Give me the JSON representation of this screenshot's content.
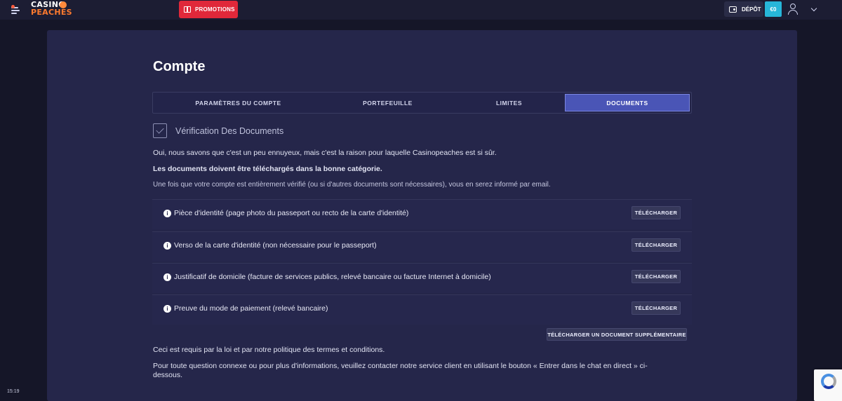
{
  "header": {
    "logo_line1": "CASINO",
    "logo_line2": "PEACHES",
    "promo_label": "PROMOTIONS",
    "deposit_label": "DÉPÔT",
    "balance": "€0"
  },
  "page": {
    "title": "Compte"
  },
  "tabs": [
    {
      "label": "PARAMÈTRES DU COMPTE",
      "active": false
    },
    {
      "label": "PORTEFEUILLE",
      "active": false
    },
    {
      "label": "LIMITES",
      "active": false
    },
    {
      "label": "DOCUMENTS",
      "active": true
    }
  ],
  "verification": {
    "title": "Vérification Des Documents",
    "intro": "Oui, nous savons que c'est un peu ennuyeux, mais c'est la raison pour laquelle Casinopeaches est si sûr.",
    "warning": "Les documents doivent être téléchargés dans la bonne catégorie.",
    "notice": "Une fois que votre compte est entièrement vérifié (ou si d'autres documents sont nécessaires), vous en serez informé par email."
  },
  "documents": [
    {
      "label": "Pièce d'identité (page photo du passeport ou recto de la carte d'identité)",
      "button": "TÉLÉCHARGER"
    },
    {
      "label": "Verso de la carte d'identité (non nécessaire pour le passeport)",
      "button": "TÉLÉCHARGER"
    },
    {
      "label": "Justificatif de domicile (facture de services publics, relevé bancaire ou facture Internet à domicile)",
      "button": "TÉLÉCHARGER"
    },
    {
      "label": "Preuve du mode de paiement (relevé bancaire)",
      "button": "TÉLÉCHARGER"
    }
  ],
  "extra_upload_label": "TÉLÉCHARGER UN DOCUMENT SUPPLÉMENTAIRE",
  "footer": {
    "legal": "Ceci est requis par la loi et par notre politique des termes et conditions.",
    "contact": "Pour toute question connexe ou pour plus d'informations, veuillez contacter notre service client en utilisant le bouton « Entrer dans le chat en direct » ci-dessous."
  },
  "system": {
    "clock": "15:19"
  },
  "colors": {
    "background": "#151628",
    "panel": "#25264a",
    "active_tab": "#4a55b6",
    "promo": "#e0283a",
    "balance": "#27b6d9"
  }
}
